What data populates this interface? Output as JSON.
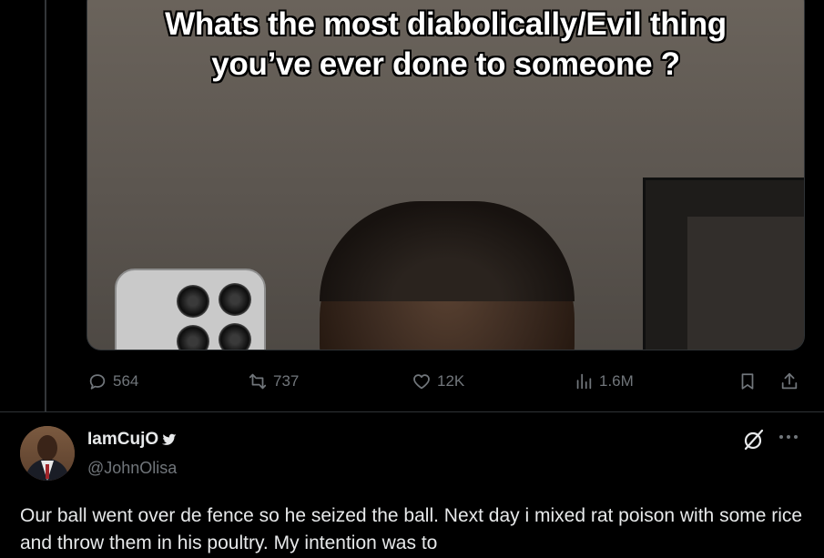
{
  "media": {
    "caption_line1": "Whats the most diabolically/Evil thing",
    "caption_line2": "you’ve ever done to someone ?"
  },
  "actions": {
    "replies": "564",
    "reposts": "737",
    "likes": "12K",
    "views": "1.6M"
  },
  "reply": {
    "display_name": "IamCujO",
    "handle": "@JohnOlisa",
    "text": "Our ball went over de fence so he seized the ball. Next day i mixed rat poison with some rice and throw them in his poultry. My intention was to"
  },
  "colors": {
    "background": "#000000",
    "text": "#e7e9ea",
    "muted": "#71767b",
    "border": "#2f3336"
  }
}
